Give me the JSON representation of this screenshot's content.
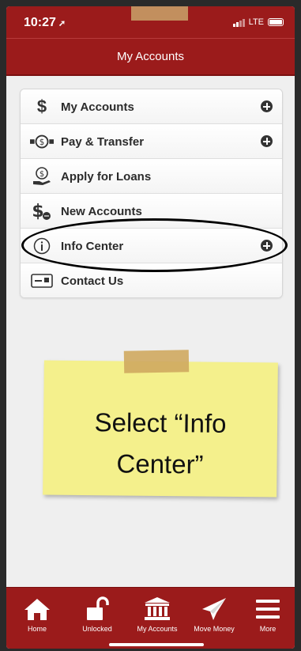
{
  "status_bar": {
    "time": "10:27",
    "network": "LTE"
  },
  "nav": {
    "title": "My Accounts"
  },
  "menu": {
    "items": [
      {
        "label": "My Accounts",
        "icon": "dollar-icon",
        "expandable": true
      },
      {
        "label": "Pay & Transfer",
        "icon": "money-transfer-icon",
        "expandable": true
      },
      {
        "label": "Apply for Loans",
        "icon": "loan-hand-icon",
        "expandable": false
      },
      {
        "label": "New Accounts",
        "icon": "new-account-icon",
        "expandable": false
      },
      {
        "label": "Info Center",
        "icon": "info-icon",
        "expandable": true
      },
      {
        "label": "Contact Us",
        "icon": "contact-card-icon",
        "expandable": false
      }
    ]
  },
  "sticky_note": {
    "text": "Select “Info\nCenter”"
  },
  "tab_bar": {
    "tabs": [
      {
        "label": "Home",
        "icon": "home-icon"
      },
      {
        "label": "Unlocked",
        "icon": "unlock-icon"
      },
      {
        "label": "My Accounts",
        "icon": "bank-icon"
      },
      {
        "label": "Move Money",
        "icon": "paper-plane-icon"
      },
      {
        "label": "More",
        "icon": "hamburger-icon"
      }
    ]
  },
  "colors": {
    "brand_red": "#9b1b1b",
    "background": "#efefef",
    "sticky_yellow": "#f4f08c"
  }
}
